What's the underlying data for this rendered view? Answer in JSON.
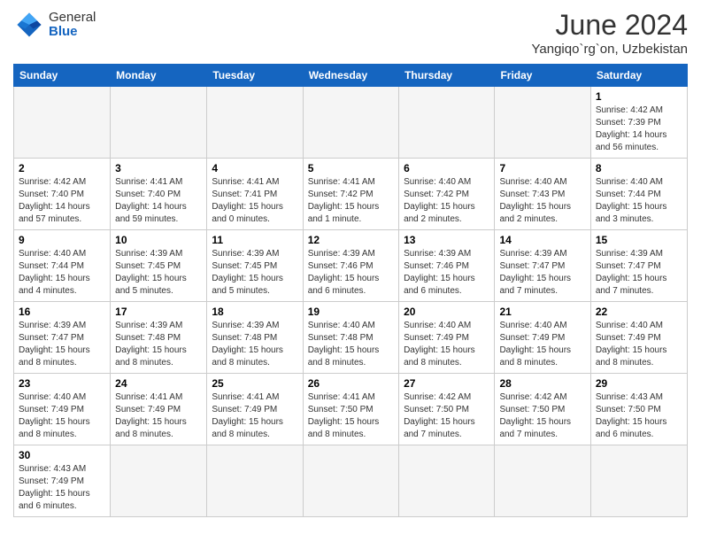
{
  "header": {
    "logo_general": "General",
    "logo_blue": "Blue",
    "month_title": "June 2024",
    "location": "Yangiqo`rg`on, Uzbekistan"
  },
  "days_of_week": [
    "Sunday",
    "Monday",
    "Tuesday",
    "Wednesday",
    "Thursday",
    "Friday",
    "Saturday"
  ],
  "weeks": [
    [
      {
        "day": "",
        "info": ""
      },
      {
        "day": "",
        "info": ""
      },
      {
        "day": "",
        "info": ""
      },
      {
        "day": "",
        "info": ""
      },
      {
        "day": "",
        "info": ""
      },
      {
        "day": "",
        "info": ""
      },
      {
        "day": "1",
        "info": "Sunrise: 4:42 AM\nSunset: 7:39 PM\nDaylight: 14 hours and 56 minutes."
      }
    ],
    [
      {
        "day": "2",
        "info": "Sunrise: 4:42 AM\nSunset: 7:40 PM\nDaylight: 14 hours and 57 minutes."
      },
      {
        "day": "3",
        "info": "Sunrise: 4:41 AM\nSunset: 7:40 PM\nDaylight: 14 hours and 59 minutes."
      },
      {
        "day": "4",
        "info": "Sunrise: 4:41 AM\nSunset: 7:41 PM\nDaylight: 15 hours and 0 minutes."
      },
      {
        "day": "5",
        "info": "Sunrise: 4:41 AM\nSunset: 7:42 PM\nDaylight: 15 hours and 1 minute."
      },
      {
        "day": "6",
        "info": "Sunrise: 4:40 AM\nSunset: 7:42 PM\nDaylight: 15 hours and 2 minutes."
      },
      {
        "day": "7",
        "info": "Sunrise: 4:40 AM\nSunset: 7:43 PM\nDaylight: 15 hours and 2 minutes."
      },
      {
        "day": "8",
        "info": "Sunrise: 4:40 AM\nSunset: 7:44 PM\nDaylight: 15 hours and 3 minutes."
      }
    ],
    [
      {
        "day": "9",
        "info": "Sunrise: 4:40 AM\nSunset: 7:44 PM\nDaylight: 15 hours and 4 minutes."
      },
      {
        "day": "10",
        "info": "Sunrise: 4:39 AM\nSunset: 7:45 PM\nDaylight: 15 hours and 5 minutes."
      },
      {
        "day": "11",
        "info": "Sunrise: 4:39 AM\nSunset: 7:45 PM\nDaylight: 15 hours and 5 minutes."
      },
      {
        "day": "12",
        "info": "Sunrise: 4:39 AM\nSunset: 7:46 PM\nDaylight: 15 hours and 6 minutes."
      },
      {
        "day": "13",
        "info": "Sunrise: 4:39 AM\nSunset: 7:46 PM\nDaylight: 15 hours and 6 minutes."
      },
      {
        "day": "14",
        "info": "Sunrise: 4:39 AM\nSunset: 7:47 PM\nDaylight: 15 hours and 7 minutes."
      },
      {
        "day": "15",
        "info": "Sunrise: 4:39 AM\nSunset: 7:47 PM\nDaylight: 15 hours and 7 minutes."
      }
    ],
    [
      {
        "day": "16",
        "info": "Sunrise: 4:39 AM\nSunset: 7:47 PM\nDaylight: 15 hours and 8 minutes."
      },
      {
        "day": "17",
        "info": "Sunrise: 4:39 AM\nSunset: 7:48 PM\nDaylight: 15 hours and 8 minutes."
      },
      {
        "day": "18",
        "info": "Sunrise: 4:39 AM\nSunset: 7:48 PM\nDaylight: 15 hours and 8 minutes."
      },
      {
        "day": "19",
        "info": "Sunrise: 4:40 AM\nSunset: 7:48 PM\nDaylight: 15 hours and 8 minutes."
      },
      {
        "day": "20",
        "info": "Sunrise: 4:40 AM\nSunset: 7:49 PM\nDaylight: 15 hours and 8 minutes."
      },
      {
        "day": "21",
        "info": "Sunrise: 4:40 AM\nSunset: 7:49 PM\nDaylight: 15 hours and 8 minutes."
      },
      {
        "day": "22",
        "info": "Sunrise: 4:40 AM\nSunset: 7:49 PM\nDaylight: 15 hours and 8 minutes."
      }
    ],
    [
      {
        "day": "23",
        "info": "Sunrise: 4:40 AM\nSunset: 7:49 PM\nDaylight: 15 hours and 8 minutes."
      },
      {
        "day": "24",
        "info": "Sunrise: 4:41 AM\nSunset: 7:49 PM\nDaylight: 15 hours and 8 minutes."
      },
      {
        "day": "25",
        "info": "Sunrise: 4:41 AM\nSunset: 7:49 PM\nDaylight: 15 hours and 8 minutes."
      },
      {
        "day": "26",
        "info": "Sunrise: 4:41 AM\nSunset: 7:50 PM\nDaylight: 15 hours and 8 minutes."
      },
      {
        "day": "27",
        "info": "Sunrise: 4:42 AM\nSunset: 7:50 PM\nDaylight: 15 hours and 7 minutes."
      },
      {
        "day": "28",
        "info": "Sunrise: 4:42 AM\nSunset: 7:50 PM\nDaylight: 15 hours and 7 minutes."
      },
      {
        "day": "29",
        "info": "Sunrise: 4:43 AM\nSunset: 7:50 PM\nDaylight: 15 hours and 6 minutes."
      }
    ],
    [
      {
        "day": "30",
        "info": "Sunrise: 4:43 AM\nSunset: 7:49 PM\nDaylight: 15 hours and 6 minutes."
      },
      {
        "day": "",
        "info": ""
      },
      {
        "day": "",
        "info": ""
      },
      {
        "day": "",
        "info": ""
      },
      {
        "day": "",
        "info": ""
      },
      {
        "day": "",
        "info": ""
      },
      {
        "day": "",
        "info": ""
      }
    ]
  ]
}
